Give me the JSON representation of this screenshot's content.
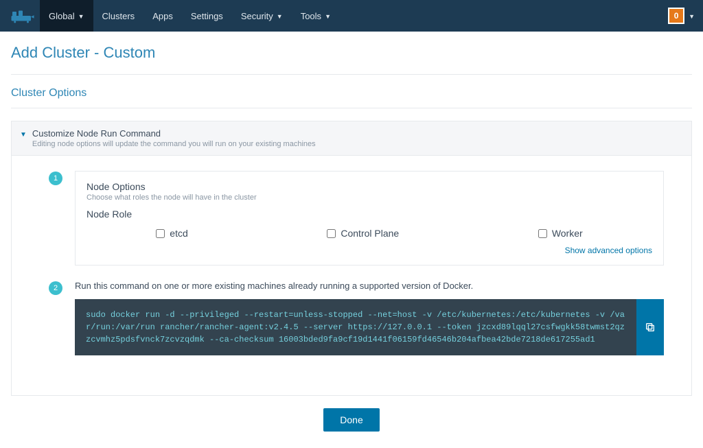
{
  "nav": {
    "global": "Global",
    "clusters": "Clusters",
    "apps": "Apps",
    "settings": "Settings",
    "security": "Security",
    "tools": "Tools",
    "userInitial": "0"
  },
  "page": {
    "title": "Add Cluster - Custom",
    "sectionTitle": "Cluster Options"
  },
  "panel": {
    "header": "Customize Node Run Command",
    "subheader": "Editing node options will update the command you will run on your existing machines"
  },
  "step1": {
    "num": "1",
    "title": "Node Options",
    "subtitle": "Choose what roles the node will have in the cluster",
    "roleLabel": "Node Role",
    "roles": {
      "etcd": "etcd",
      "cp": "Control Plane",
      "worker": "Worker"
    },
    "advanced": "Show advanced options"
  },
  "step2": {
    "num": "2",
    "desc": "Run this command on one or more existing machines already running a supported version of Docker.",
    "command": "sudo docker run -d --privileged --restart=unless-stopped --net=host -v /etc/kubernetes:/etc/kubernetes -v /var/run:/var/run rancher/rancher-agent:v2.4.5 --server https://127.0.0.1 --token jzcxd89lqql27csfwgkk58twmst2qzzcvmhz5pdsfvnck7zcvzqdmk --ca-checksum 16003bded9fa9cf19d1441f06159fd46546b204afbea42bde7218de617255ad1"
  },
  "done": "Done"
}
